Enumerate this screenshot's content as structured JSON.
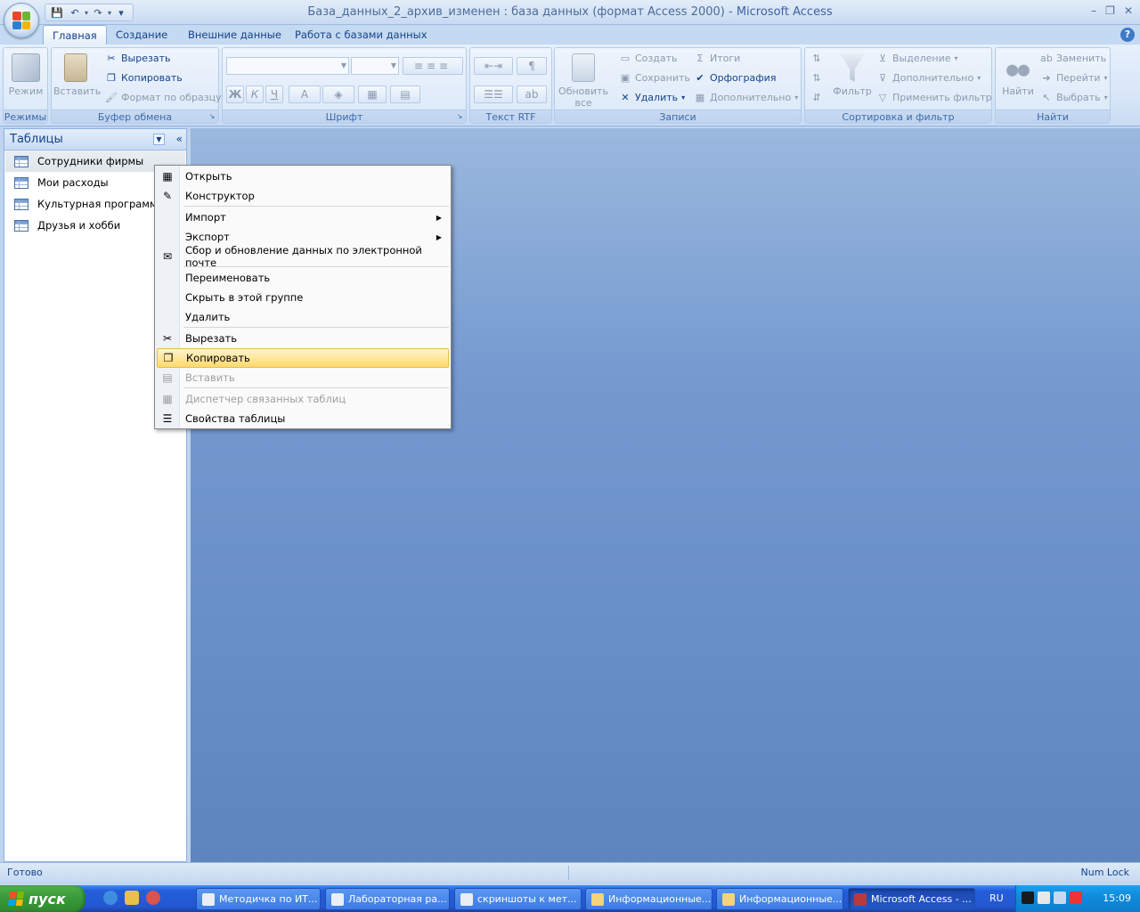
{
  "window": {
    "title": "База_данных_2_архив_изменен : база данных (формат Access 2000) - ",
    "app_name": "Microsoft Access",
    "controls": [
      "–",
      "❐",
      "✕"
    ]
  },
  "ribbon_tabs": [
    {
      "label": "Главная",
      "active": true
    },
    {
      "label": "Создание",
      "active": false
    },
    {
      "label": "Внешние данные",
      "active": false
    },
    {
      "label": "Работа с базами данных",
      "active": false
    }
  ],
  "ribbon": {
    "groups": {
      "views": "Режимы",
      "clipboard": "Буфер обмена",
      "font": "Шрифт",
      "rich_text": "Текст RTF",
      "records": "Записи",
      "sort_filter": "Сортировка и фильтр",
      "find": "Найти"
    },
    "views": {
      "mode": "Режим"
    },
    "clipboard": {
      "paste": "Вставить",
      "cut": "Вырезать",
      "copy": "Копировать",
      "format_painter": "Формат по образцу"
    },
    "records": {
      "refresh_line1": "Обновить",
      "refresh_line2": "все",
      "new": "Создать",
      "save": "Сохранить",
      "delete": "Удалить",
      "totals": "Итоги",
      "spelling": "Орфография",
      "more": "Дополнительно"
    },
    "sort_filter": {
      "filter": "Фильтр",
      "selection": "Выделение",
      "advanced": "Дополнительно",
      "toggle": "Применить фильтр"
    },
    "find": {
      "find": "Найти",
      "replace": "Заменить",
      "goto": "Перейти",
      "select": "Выбрать"
    },
    "font": {
      "bold": "Ж",
      "italic": "К",
      "underline": "Ч",
      "font_color": "A"
    }
  },
  "nav": {
    "header": "Таблицы",
    "items": [
      {
        "label": "Сотрудники фирмы",
        "selected": true
      },
      {
        "label": "Мои расходы",
        "selected": false
      },
      {
        "label": "Культурная программа",
        "selected": false
      },
      {
        "label": "Друзья и хобби",
        "selected": false
      }
    ]
  },
  "context_menu": {
    "items": [
      {
        "label": "Открыть",
        "icon": "open-icon",
        "disabled": false
      },
      {
        "label": "Конструктор",
        "icon": "design-icon",
        "disabled": false
      },
      {
        "label": "Импорт",
        "icon": "",
        "submenu": true,
        "disabled": false
      },
      {
        "label": "Экспорт",
        "icon": "",
        "submenu": true,
        "disabled": false
      },
      {
        "label": "Сбор и обновление данных по электронной почте",
        "icon": "mail-collect-icon",
        "disabled": false
      },
      {
        "label": "Переименовать",
        "icon": "",
        "disabled": false
      },
      {
        "label": "Скрыть в этой группе",
        "icon": "",
        "disabled": false
      },
      {
        "label": "Удалить",
        "icon": "",
        "disabled": false
      },
      {
        "label": "Вырезать",
        "icon": "scissors-icon",
        "disabled": false
      },
      {
        "label": "Копировать",
        "icon": "copy-icon",
        "disabled": false,
        "highlighted": true
      },
      {
        "label": "Вставить",
        "icon": "paste-icon",
        "disabled": true
      },
      {
        "label": "Диспетчер связанных таблиц",
        "icon": "linked-table-icon",
        "disabled": true
      },
      {
        "label": "Свойства таблицы",
        "icon": "properties-icon",
        "disabled": false
      }
    ]
  },
  "statusbar": {
    "status": "Готово",
    "numlock": "Num Lock"
  },
  "taskbar": {
    "start": "пуск",
    "tasks": [
      {
        "label": "Методичка по ИТ...",
        "active": false
      },
      {
        "label": "Лабораторная ра...",
        "active": false
      },
      {
        "label": "скриншоты к мет...",
        "active": false
      },
      {
        "label": "Информационные...",
        "active": false
      },
      {
        "label": "Информационные...",
        "active": false
      },
      {
        "label": "Microsoft Access - ...",
        "active": true
      }
    ],
    "lang": "RU",
    "clock": "15:09"
  },
  "colors": {
    "highlight": "#ffd96b",
    "workspace": "#7399cf",
    "taskbar": "#245edb",
    "start": "#3a9c3a"
  }
}
